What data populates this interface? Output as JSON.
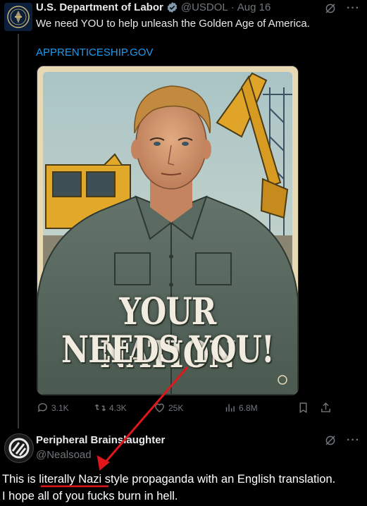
{
  "post": {
    "display_name": "U.S. Department of Labor",
    "handle": "@USDOL",
    "separator": "·",
    "date": "Aug 16",
    "text": "We need YOU to help unleash the Golden Age of America.",
    "link": "APPRENTICESHIP.GOV",
    "poster_line1": "YOUR NATION",
    "poster_line2": "NEEDS YOU!",
    "stats": {
      "replies": "3.1K",
      "reposts": "4.3K",
      "likes": "25K",
      "views": "6.8M"
    }
  },
  "reply": {
    "display_name": "Peripheral Brainslaughter",
    "handle": "@Nealsoad"
  },
  "comment": {
    "part1": "This is ",
    "highlight": "literally Nazi",
    "part2": " style propaganda with an English translation.",
    "line2": "I hope all of you fucks burn in hell."
  },
  "colors": {
    "background": "#000000",
    "link": "#1d9bf0",
    "muted": "#71767b",
    "annotation": "#e0161b"
  },
  "icons": [
    "grok-icon",
    "more-icon",
    "verified-badge-icon",
    "reply-icon",
    "repost-icon",
    "like-icon",
    "views-icon",
    "bookmark-icon",
    "share-icon"
  ]
}
